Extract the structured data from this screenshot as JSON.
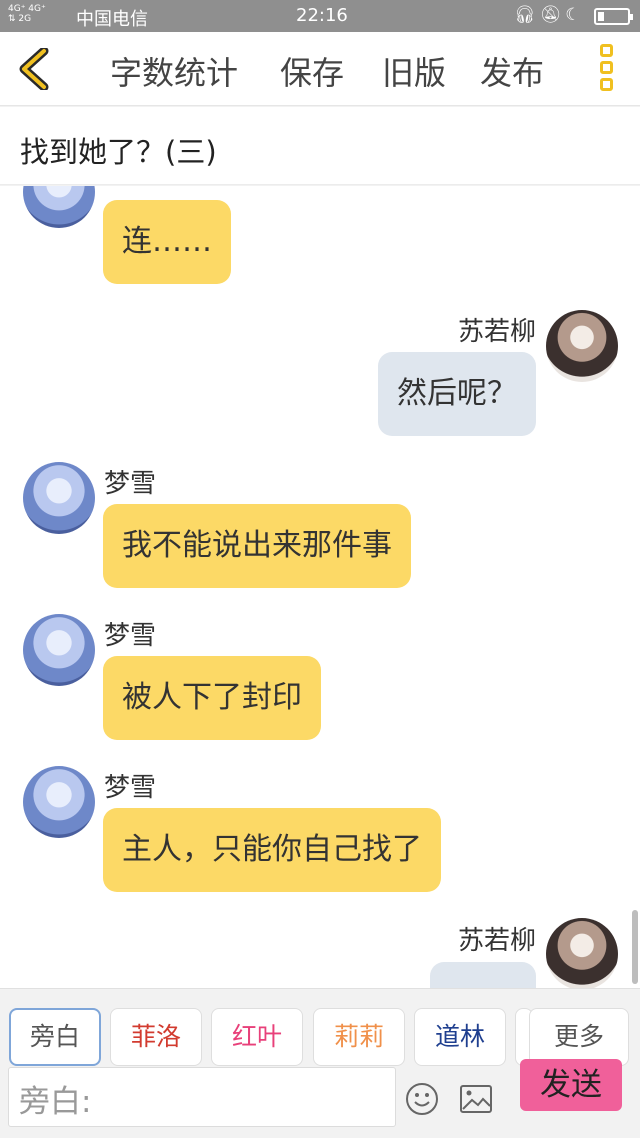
{
  "status_bar": {
    "network": "4G⁺ 4G⁺\n⇅ 2G",
    "carrier": "中国电信",
    "time": "22:16",
    "icons": [
      "headset-icon",
      "bell-icon",
      "moon-icon",
      "battery-icon"
    ],
    "battery_level": 0.2
  },
  "toolbar": {
    "back_icon": "chevron-left-icon",
    "word_count": "字数统计",
    "save": "保存",
    "old_version": "旧版",
    "publish": "发布",
    "menu_icon": "vertical-dots-icon",
    "accent_color": "#f0c020"
  },
  "title": "找到她了？(三)",
  "messages": [
    {
      "speaker": "梦雪",
      "text": "连……",
      "side": "left",
      "bubble_color": "#fcd966"
    },
    {
      "speaker": "苏若柳",
      "text": "然后呢？",
      "side": "right",
      "bubble_color": "#dfe6ee"
    },
    {
      "speaker": "梦雪",
      "text": "我不能说出来那件事",
      "side": "left",
      "bubble_color": "#fcd966"
    },
    {
      "speaker": "梦雪",
      "text": "被人下了封印",
      "side": "left",
      "bubble_color": "#fcd966"
    },
    {
      "speaker": "梦雪",
      "text": "主人，只能你自己找了",
      "side": "left",
      "bubble_color": "#fcd966"
    },
    {
      "speaker": "苏若柳",
      "text": "",
      "side": "right",
      "bubble_color": "#dfe6ee"
    }
  ],
  "roles": [
    {
      "label": "旁白",
      "color": "#555555",
      "selected": true
    },
    {
      "label": "菲洛",
      "color": "#d23b2f"
    },
    {
      "label": "红叶",
      "color": "#e8407a"
    },
    {
      "label": "莉莉",
      "color": "#f0904a"
    },
    {
      "label": "道林",
      "color": "#1f3f8f"
    },
    {
      "label": "",
      "color": "#555555"
    },
    {
      "label": "更多",
      "color": "#555555"
    }
  ],
  "input": {
    "placeholder": "旁白:"
  },
  "icons": {
    "emoji": "smile-icon",
    "image": "image-icon"
  },
  "send": {
    "label": "发送",
    "color": "#f0609a"
  }
}
